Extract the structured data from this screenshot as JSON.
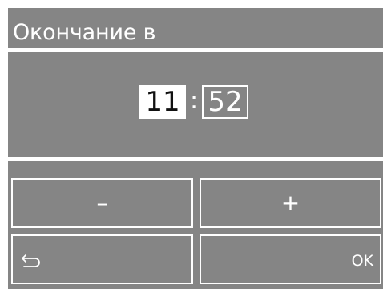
{
  "header": {
    "title": "Окончание в"
  },
  "time": {
    "hours": "11",
    "separator": ":",
    "minutes": "52",
    "active_field": "hours"
  },
  "buttons": {
    "minus_label": "–",
    "plus_label": "+",
    "back_icon": "return-arrow-icon",
    "ok_label": "OK"
  },
  "colors": {
    "screen_background": "#858585",
    "foreground": "#ffffff",
    "active_field_text": "#111111"
  }
}
